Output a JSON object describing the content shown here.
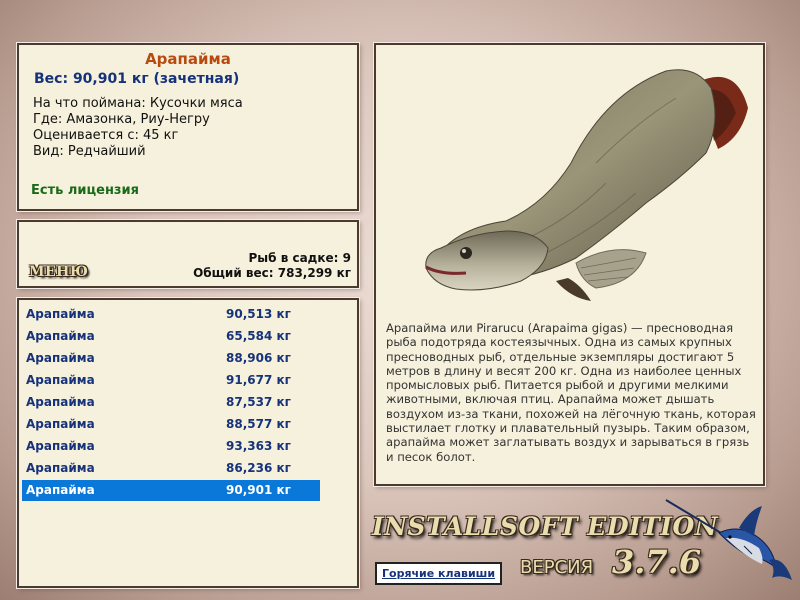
{
  "fish": {
    "title": "Арапайма",
    "weight": "Вес: 90,901 кг (зачетная)",
    "caught_with": "На что поймана: Кусочки мяса",
    "location": "Где: Амазонка, Риу-Негру",
    "valued_from": "Оценивается с: 45 кг",
    "rarity": "Вид: Редчайший",
    "license": "Есть лицензия"
  },
  "cage": {
    "menu_label": "МЕНЮ",
    "count": "Рыб в садке: 9",
    "total_weight": "Общий вес: 783,299 кг"
  },
  "catch_list": [
    {
      "name": "Арапайма",
      "weight": "90,513 кг"
    },
    {
      "name": "Арапайма",
      "weight": "65,584 кг"
    },
    {
      "name": "Арапайма",
      "weight": "88,906 кг"
    },
    {
      "name": "Арапайма",
      "weight": "91,677 кг"
    },
    {
      "name": "Арапайма",
      "weight": "87,537 кг"
    },
    {
      "name": "Арапайма",
      "weight": "88,577 кг"
    },
    {
      "name": "Арапайма",
      "weight": "93,363 кг"
    },
    {
      "name": "Арапайма",
      "weight": "86,236 кг"
    },
    {
      "name": "Арапайма",
      "weight": "90,901 кг",
      "selected": true
    }
  ],
  "description": "Арапайма или Pirarucu (Arapaima gigas) — пресноводная рыба подотряда костеязычных. Одна из самых крупных пресноводных рыб, отдельные экземпляры достигают 5 метров в длину и весят 200 кг. Одна из наиболее ценных промысловых рыб. Питается рыбой и другими мелкими животными, включая птиц. Арапайма может дышать воздухом из-за ткани, похожей на лёгочную ткань, которая выстилает глотку и плавательный пузырь. Таким образом, арапайма может заглатывать воздух и зарываться в грязь и песок болот.",
  "branding": {
    "edition": "INSTALLSOFT EDITION",
    "version_label": "ВЕРСИЯ",
    "version_number": "3.7.6"
  },
  "hotkeys_label": "Горячие клавиши",
  "colors": {
    "title": "#b84a10",
    "weight_text": "#16327a",
    "license": "#1a6a1a",
    "selection": "#0a78d8",
    "panel_bg": "#f6f1dc"
  },
  "icons": {
    "fish_image": "arapaima-fish-picture",
    "logo": "marlin-logo"
  }
}
